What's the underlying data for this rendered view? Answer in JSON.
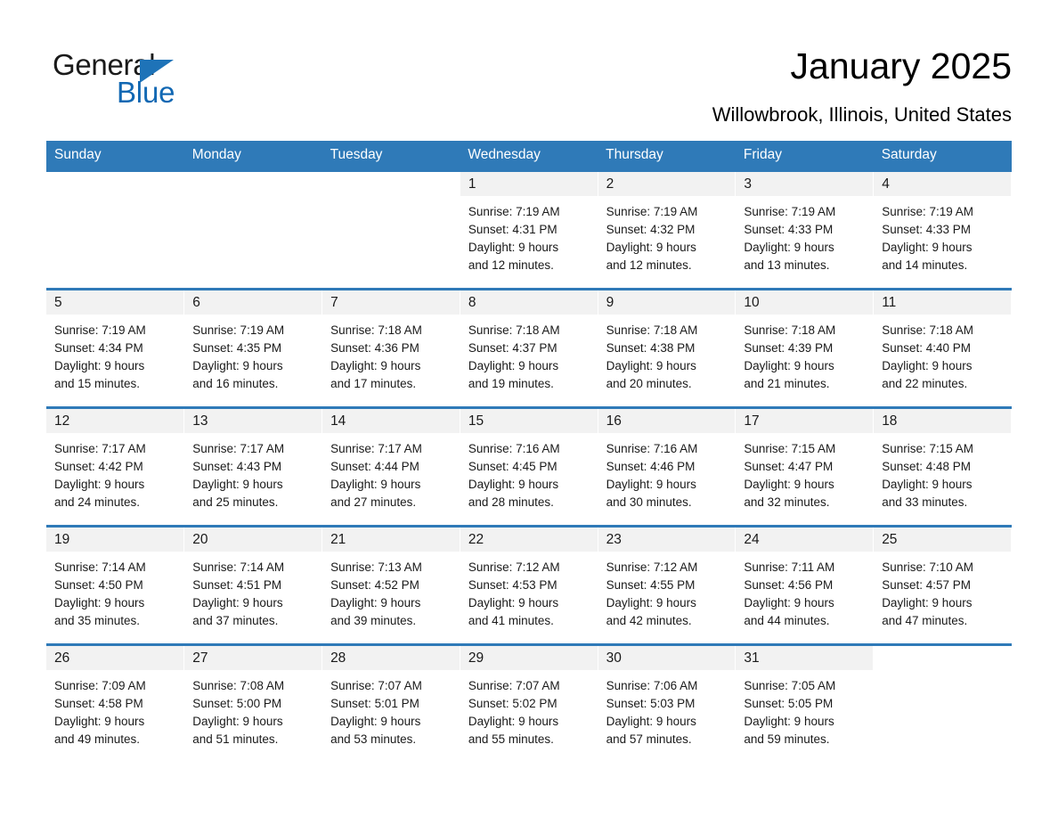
{
  "brand": {
    "name_part1": "General",
    "name_part2": "Blue",
    "accent_color": "#1268b3",
    "triangle_color": "#1e73b8"
  },
  "header": {
    "title": "January 2025",
    "subtitle": "Willowbrook, Illinois, United States"
  },
  "calendar": {
    "header_bg": "#2f7ab8",
    "row_rule_color": "#2f7ab8",
    "daynum_band_bg": "#f2f2f2",
    "weekday_headers": [
      "Sunday",
      "Monday",
      "Tuesday",
      "Wednesday",
      "Thursday",
      "Friday",
      "Saturday"
    ],
    "weeks": [
      [
        {
          "day": "",
          "sunrise": "",
          "sunset": "",
          "daylight1": "",
          "daylight2": ""
        },
        {
          "day": "",
          "sunrise": "",
          "sunset": "",
          "daylight1": "",
          "daylight2": ""
        },
        {
          "day": "",
          "sunrise": "",
          "sunset": "",
          "daylight1": "",
          "daylight2": ""
        },
        {
          "day": "1",
          "sunrise": "Sunrise: 7:19 AM",
          "sunset": "Sunset: 4:31 PM",
          "daylight1": "Daylight: 9 hours",
          "daylight2": "and 12 minutes."
        },
        {
          "day": "2",
          "sunrise": "Sunrise: 7:19 AM",
          "sunset": "Sunset: 4:32 PM",
          "daylight1": "Daylight: 9 hours",
          "daylight2": "and 12 minutes."
        },
        {
          "day": "3",
          "sunrise": "Sunrise: 7:19 AM",
          "sunset": "Sunset: 4:33 PM",
          "daylight1": "Daylight: 9 hours",
          "daylight2": "and 13 minutes."
        },
        {
          "day": "4",
          "sunrise": "Sunrise: 7:19 AM",
          "sunset": "Sunset: 4:33 PM",
          "daylight1": "Daylight: 9 hours",
          "daylight2": "and 14 minutes."
        }
      ],
      [
        {
          "day": "5",
          "sunrise": "Sunrise: 7:19 AM",
          "sunset": "Sunset: 4:34 PM",
          "daylight1": "Daylight: 9 hours",
          "daylight2": "and 15 minutes."
        },
        {
          "day": "6",
          "sunrise": "Sunrise: 7:19 AM",
          "sunset": "Sunset: 4:35 PM",
          "daylight1": "Daylight: 9 hours",
          "daylight2": "and 16 minutes."
        },
        {
          "day": "7",
          "sunrise": "Sunrise: 7:18 AM",
          "sunset": "Sunset: 4:36 PM",
          "daylight1": "Daylight: 9 hours",
          "daylight2": "and 17 minutes."
        },
        {
          "day": "8",
          "sunrise": "Sunrise: 7:18 AM",
          "sunset": "Sunset: 4:37 PM",
          "daylight1": "Daylight: 9 hours",
          "daylight2": "and 19 minutes."
        },
        {
          "day": "9",
          "sunrise": "Sunrise: 7:18 AM",
          "sunset": "Sunset: 4:38 PM",
          "daylight1": "Daylight: 9 hours",
          "daylight2": "and 20 minutes."
        },
        {
          "day": "10",
          "sunrise": "Sunrise: 7:18 AM",
          "sunset": "Sunset: 4:39 PM",
          "daylight1": "Daylight: 9 hours",
          "daylight2": "and 21 minutes."
        },
        {
          "day": "11",
          "sunrise": "Sunrise: 7:18 AM",
          "sunset": "Sunset: 4:40 PM",
          "daylight1": "Daylight: 9 hours",
          "daylight2": "and 22 minutes."
        }
      ],
      [
        {
          "day": "12",
          "sunrise": "Sunrise: 7:17 AM",
          "sunset": "Sunset: 4:42 PM",
          "daylight1": "Daylight: 9 hours",
          "daylight2": "and 24 minutes."
        },
        {
          "day": "13",
          "sunrise": "Sunrise: 7:17 AM",
          "sunset": "Sunset: 4:43 PM",
          "daylight1": "Daylight: 9 hours",
          "daylight2": "and 25 minutes."
        },
        {
          "day": "14",
          "sunrise": "Sunrise: 7:17 AM",
          "sunset": "Sunset: 4:44 PM",
          "daylight1": "Daylight: 9 hours",
          "daylight2": "and 27 minutes."
        },
        {
          "day": "15",
          "sunrise": "Sunrise: 7:16 AM",
          "sunset": "Sunset: 4:45 PM",
          "daylight1": "Daylight: 9 hours",
          "daylight2": "and 28 minutes."
        },
        {
          "day": "16",
          "sunrise": "Sunrise: 7:16 AM",
          "sunset": "Sunset: 4:46 PM",
          "daylight1": "Daylight: 9 hours",
          "daylight2": "and 30 minutes."
        },
        {
          "day": "17",
          "sunrise": "Sunrise: 7:15 AM",
          "sunset": "Sunset: 4:47 PM",
          "daylight1": "Daylight: 9 hours",
          "daylight2": "and 32 minutes."
        },
        {
          "day": "18",
          "sunrise": "Sunrise: 7:15 AM",
          "sunset": "Sunset: 4:48 PM",
          "daylight1": "Daylight: 9 hours",
          "daylight2": "and 33 minutes."
        }
      ],
      [
        {
          "day": "19",
          "sunrise": "Sunrise: 7:14 AM",
          "sunset": "Sunset: 4:50 PM",
          "daylight1": "Daylight: 9 hours",
          "daylight2": "and 35 minutes."
        },
        {
          "day": "20",
          "sunrise": "Sunrise: 7:14 AM",
          "sunset": "Sunset: 4:51 PM",
          "daylight1": "Daylight: 9 hours",
          "daylight2": "and 37 minutes."
        },
        {
          "day": "21",
          "sunrise": "Sunrise: 7:13 AM",
          "sunset": "Sunset: 4:52 PM",
          "daylight1": "Daylight: 9 hours",
          "daylight2": "and 39 minutes."
        },
        {
          "day": "22",
          "sunrise": "Sunrise: 7:12 AM",
          "sunset": "Sunset: 4:53 PM",
          "daylight1": "Daylight: 9 hours",
          "daylight2": "and 41 minutes."
        },
        {
          "day": "23",
          "sunrise": "Sunrise: 7:12 AM",
          "sunset": "Sunset: 4:55 PM",
          "daylight1": "Daylight: 9 hours",
          "daylight2": "and 42 minutes."
        },
        {
          "day": "24",
          "sunrise": "Sunrise: 7:11 AM",
          "sunset": "Sunset: 4:56 PM",
          "daylight1": "Daylight: 9 hours",
          "daylight2": "and 44 minutes."
        },
        {
          "day": "25",
          "sunrise": "Sunrise: 7:10 AM",
          "sunset": "Sunset: 4:57 PM",
          "daylight1": "Daylight: 9 hours",
          "daylight2": "and 47 minutes."
        }
      ],
      [
        {
          "day": "26",
          "sunrise": "Sunrise: 7:09 AM",
          "sunset": "Sunset: 4:58 PM",
          "daylight1": "Daylight: 9 hours",
          "daylight2": "and 49 minutes."
        },
        {
          "day": "27",
          "sunrise": "Sunrise: 7:08 AM",
          "sunset": "Sunset: 5:00 PM",
          "daylight1": "Daylight: 9 hours",
          "daylight2": "and 51 minutes."
        },
        {
          "day": "28",
          "sunrise": "Sunrise: 7:07 AM",
          "sunset": "Sunset: 5:01 PM",
          "daylight1": "Daylight: 9 hours",
          "daylight2": "and 53 minutes."
        },
        {
          "day": "29",
          "sunrise": "Sunrise: 7:07 AM",
          "sunset": "Sunset: 5:02 PM",
          "daylight1": "Daylight: 9 hours",
          "daylight2": "and 55 minutes."
        },
        {
          "day": "30",
          "sunrise": "Sunrise: 7:06 AM",
          "sunset": "Sunset: 5:03 PM",
          "daylight1": "Daylight: 9 hours",
          "daylight2": "and 57 minutes."
        },
        {
          "day": "31",
          "sunrise": "Sunrise: 7:05 AM",
          "sunset": "Sunset: 5:05 PM",
          "daylight1": "Daylight: 9 hours",
          "daylight2": "and 59 minutes."
        },
        {
          "day": "",
          "sunrise": "",
          "sunset": "",
          "daylight1": "",
          "daylight2": ""
        }
      ]
    ]
  }
}
